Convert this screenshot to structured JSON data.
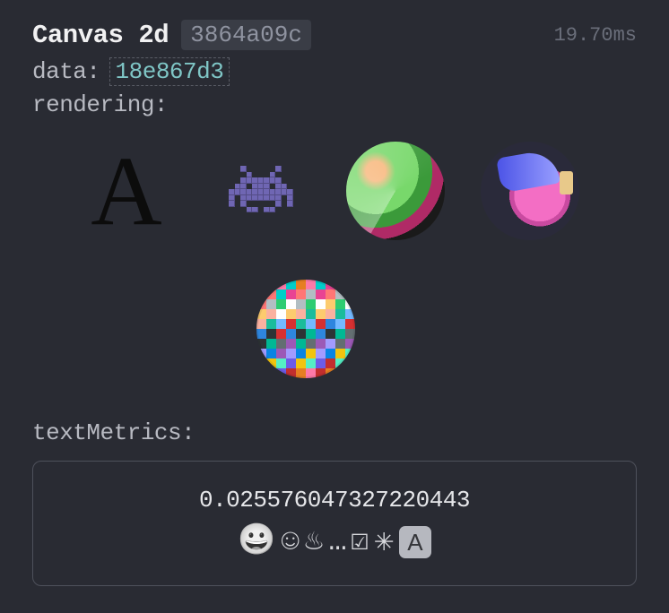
{
  "header": {
    "title": "Canvas 2d",
    "hash": "3864a09c",
    "timing": "19.70ms"
  },
  "data_row": {
    "label": "data:",
    "hash": "18e867d3"
  },
  "rendering": {
    "label": "rendering:",
    "samples": [
      {
        "id": "glyph-letter-a",
        "kind": "serif-letter"
      },
      {
        "id": "space-invader",
        "kind": "pixel-sprite"
      },
      {
        "id": "chroma-circle-a",
        "kind": "gradient-sphere"
      },
      {
        "id": "chroma-circle-b",
        "kind": "gradient-sphere"
      },
      {
        "id": "pixel-noise-circle",
        "kind": "pixel-noise"
      }
    ]
  },
  "textMetrics": {
    "label": "textMetrics:",
    "value": "0.025576047327220443",
    "glyphs": [
      "grinning-face",
      "smiling-face",
      "hot-springs",
      "ellipsis",
      "ballot-box-check",
      "eight-spoked-asterisk",
      "boxed-letter-a"
    ]
  },
  "pixel_palette": [
    "#c22e2e",
    "#2ecc71",
    "#2e86de",
    "#f1c40f",
    "#e84393",
    "#1abc9c",
    "#9b59b6",
    "#e67e22",
    "#ffffff",
    "#2d3436",
    "#55efc4",
    "#ff7675",
    "#74b9ff",
    "#a29bfe",
    "#fd79a8",
    "#fdcb6e",
    "#00b894",
    "#6c5ce7",
    "#b2bec3",
    "#d63031",
    "#0984e3",
    "#00cec9",
    "#fab1a0",
    "#636e72"
  ]
}
